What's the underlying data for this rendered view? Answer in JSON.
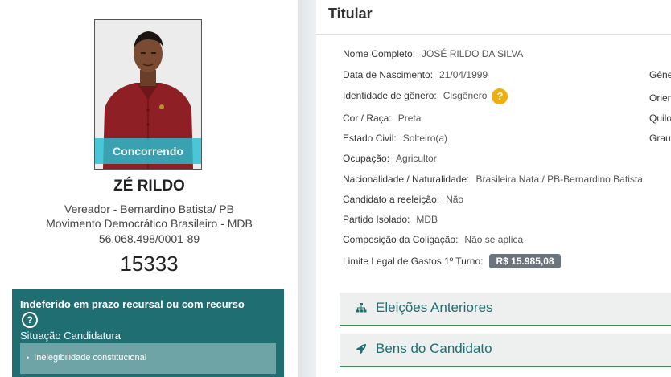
{
  "candidate": {
    "photo_badge": "Concorrendo",
    "name": "ZÉ RILDO",
    "office_line": "Vereador - Bernardino Batista/ PB",
    "party_line": "Movimento Democrático Brasileiro - MDB",
    "cnpj": "56.068.498/0001-89",
    "number": "15333"
  },
  "status": {
    "title": "Indeferido em prazo recursal ou com recurso",
    "help_icon": "?",
    "subtitle": "Situação Candidatura",
    "items": [
      "Inelegibilidade constitucional"
    ]
  },
  "titular": {
    "heading": "Titular",
    "fields": [
      {
        "label": "Nome Completo:",
        "value": "JOSÉ RILDO DA SILVA"
      },
      {
        "label": "Data de Nascimento:",
        "value": "21/04/1999"
      },
      {
        "label": "Identidade de gênero:",
        "value": "Cisgênero"
      },
      {
        "label": "Cor / Raça:",
        "value": "Preta"
      },
      {
        "label": "Estado Civil:",
        "value": "Solteiro(a)"
      },
      {
        "label": "Ocupação:",
        "value": "Agricultor"
      },
      {
        "label": "Nacionalidade / Naturalidade:",
        "value": "Brasileira Nata / PB-Bernardino Batista"
      },
      {
        "label": "Candidato a reeleição:",
        "value": "Não"
      },
      {
        "label": "Partido Isolado:",
        "value": "MDB"
      },
      {
        "label": "Composição da Coligação:",
        "value": "Não se aplica"
      },
      {
        "label": "Limite Legal de Gastos 1º Turno:",
        "value": "R$ 15.985,08"
      }
    ],
    "gender_help": "?",
    "right_labels": [
      "Gêne",
      "Orien",
      "Quilo",
      "Grau"
    ]
  },
  "accordions": {
    "previous_elections": "Eleições Anteriores",
    "assets": "Bens do Candidato"
  },
  "colors": {
    "teal_dark": "#1f6e72",
    "badge_cyan": "#26bed2",
    "help_orange": "#f0ad0e",
    "money_gray": "#6c757d",
    "accordion_border": "#3d8f57"
  }
}
